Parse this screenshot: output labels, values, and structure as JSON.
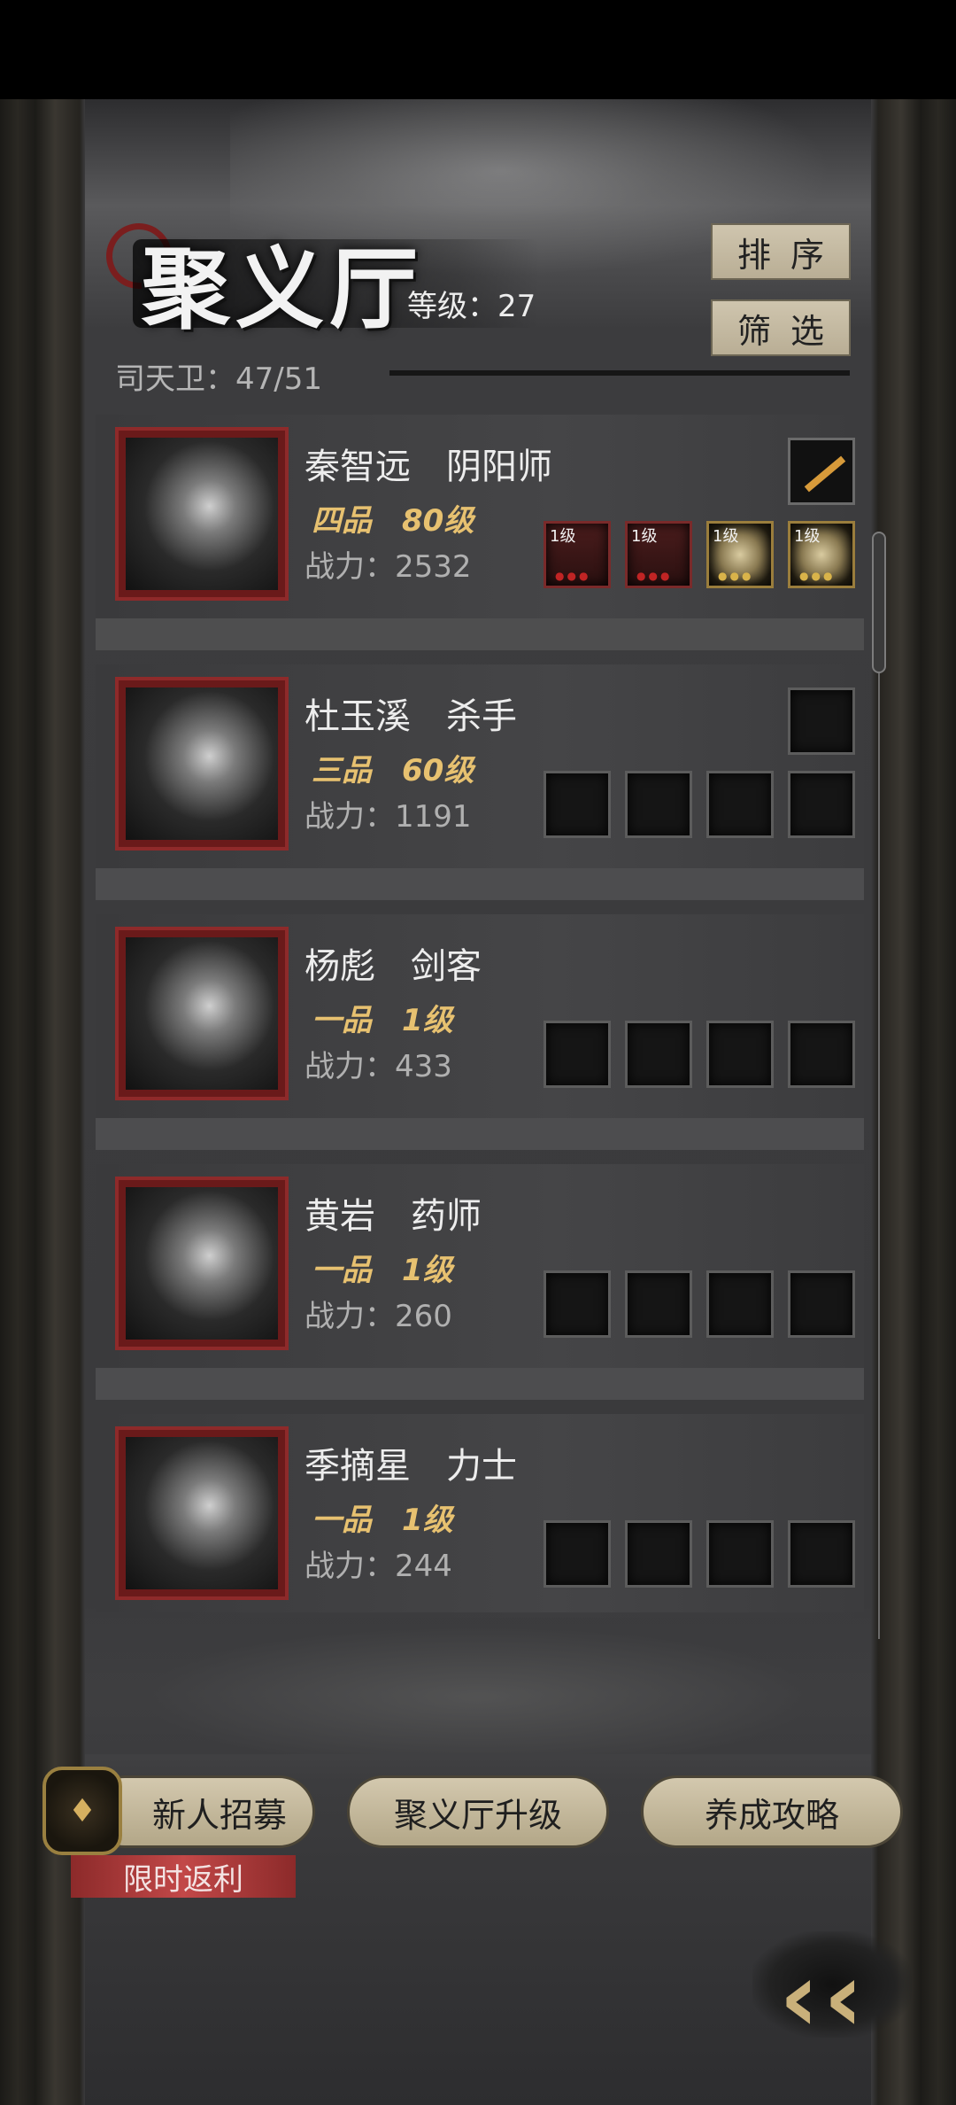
{
  "header": {
    "title": "聚义厅",
    "level_label": "等级：27",
    "guard_count": "司天卫：47/51",
    "sort_label": "排序",
    "filter_label": "筛选"
  },
  "heroes": [
    {
      "name": "秦智远　阴阳师",
      "grade": "四品　80级",
      "power": "战力：2532",
      "slots": [
        {
          "level": "1级"
        },
        {
          "level": "1级"
        },
        {
          "level": "1级"
        },
        {
          "level": "1级"
        }
      ]
    },
    {
      "name": "杜玉溪　杀手",
      "grade": "三品　60级",
      "power": "战力：1191"
    },
    {
      "name": "杨彪　剑客",
      "grade": "一品　1级",
      "power": "战力：433"
    },
    {
      "name": "黄岩　药师",
      "grade": "一品　1级",
      "power": "战力：260"
    },
    {
      "name": "季摘星　力士",
      "grade": "一品　1级",
      "power": "战力：244"
    }
  ],
  "bottom": {
    "recruit_label": "新人招募",
    "recruit_badge": "限时返利",
    "upgrade_label": "聚义厅升级",
    "guide_label": "养成攻略"
  },
  "colors": {
    "accent_gold": "#e7c170",
    "button_beige": "#c9bea4",
    "portrait_red": "#8e2a2a",
    "ribbon_red": "#c24848"
  },
  "icons": [
    "weapon-icon",
    "back-arrow-icon",
    "recruit-badge-icon"
  ]
}
